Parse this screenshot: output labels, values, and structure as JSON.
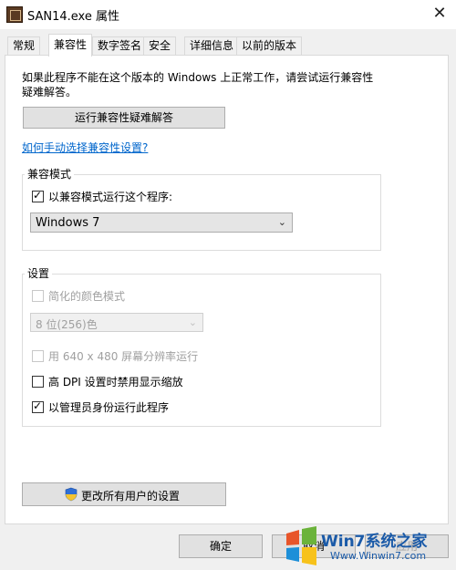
{
  "window": {
    "title": "SAN14.exe 属性",
    "close_glyph": "✕"
  },
  "tabs": [
    {
      "label": "常规"
    },
    {
      "label": "兼容性",
      "active": true
    },
    {
      "label": "数字签名"
    },
    {
      "label": "安全"
    },
    {
      "label": "详细信息"
    },
    {
      "label": "以前的版本"
    }
  ],
  "intro": {
    "line1": "如果此程序不能在这个版本的 Windows 上正常工作，请尝试运行兼容性",
    "line2": "疑难解答。"
  },
  "troubleshooter_button": "运行兼容性疑难解答",
  "manual_link": "如何手动选择兼容性设置?",
  "compat_mode": {
    "group_label": "兼容模式",
    "checkbox_label": "以兼容模式运行这个程序:",
    "checked": true,
    "selected_os": "Windows 7"
  },
  "settings": {
    "group_label": "设置",
    "reduced_color": {
      "label": "简化的颜色模式",
      "checked": false,
      "enabled": false
    },
    "color_depth": {
      "value": "8 位(256)色",
      "enabled": false
    },
    "res_640": {
      "label": "用 640 x 480 屏幕分辨率运行",
      "checked": false,
      "enabled": false
    },
    "high_dpi": {
      "label": "高 DPI 设置时禁用显示缩放",
      "checked": false,
      "enabled": true
    },
    "run_as_admin": {
      "label": "以管理员身份运行此程序",
      "checked": true,
      "enabled": true
    }
  },
  "change_all_button": "更改所有用户的设置",
  "footer": {
    "ok": "确定",
    "cancel": "取消",
    "apply": "应用"
  },
  "watermark": {
    "brand": "Win7系统之家",
    "url": "Www.Winwin7.com"
  },
  "colors": {
    "link": "#0066cc",
    "panel_bg": "#ffffff",
    "dialog_bg": "#f0f0f0"
  }
}
